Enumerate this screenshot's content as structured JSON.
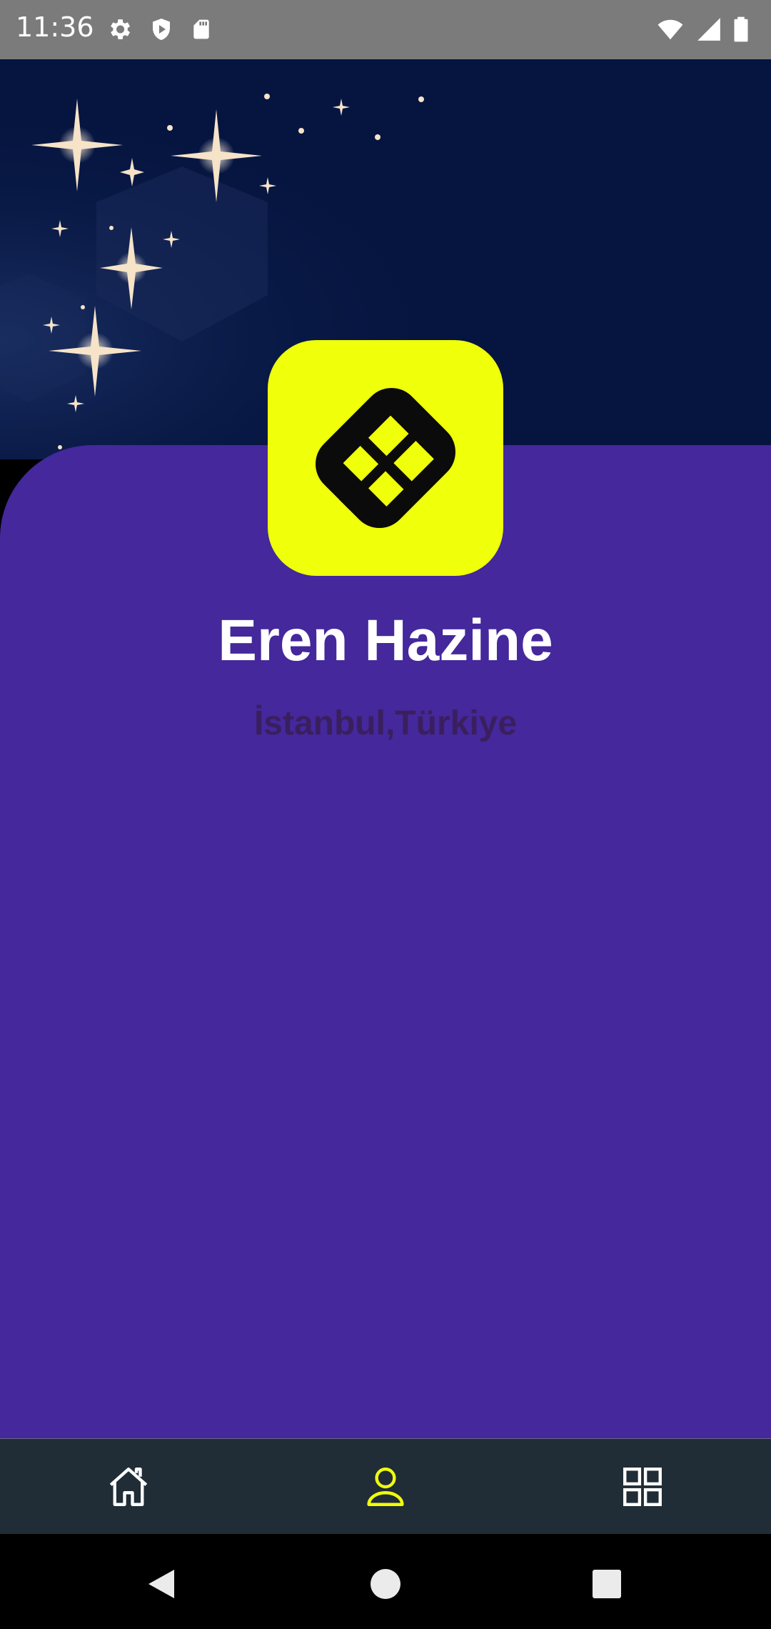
{
  "status_bar": {
    "time": "11:36",
    "left_icons": [
      "gear-icon",
      "shield-play-icon",
      "sd-card-icon"
    ],
    "right_icons": [
      "wifi-icon",
      "signal-icon",
      "battery-icon"
    ]
  },
  "profile": {
    "name": "Eren Hazine",
    "location": "İstanbul,Türkiye"
  },
  "logo": {
    "icon": "app-logo-icon",
    "background": "#f0ff0a"
  },
  "bottom_nav": {
    "items": [
      {
        "icon": "home-icon",
        "active": false
      },
      {
        "icon": "person-icon",
        "active": true
      },
      {
        "icon": "grid-icon",
        "active": false
      }
    ],
    "active_color": "#f0ff0a"
  },
  "colors": {
    "hero_bg": "#061540",
    "card_bg": "#44289c",
    "nav_bg": "#202c36",
    "name_text": "#ffffff",
    "location_text": "#3a1f5e"
  }
}
